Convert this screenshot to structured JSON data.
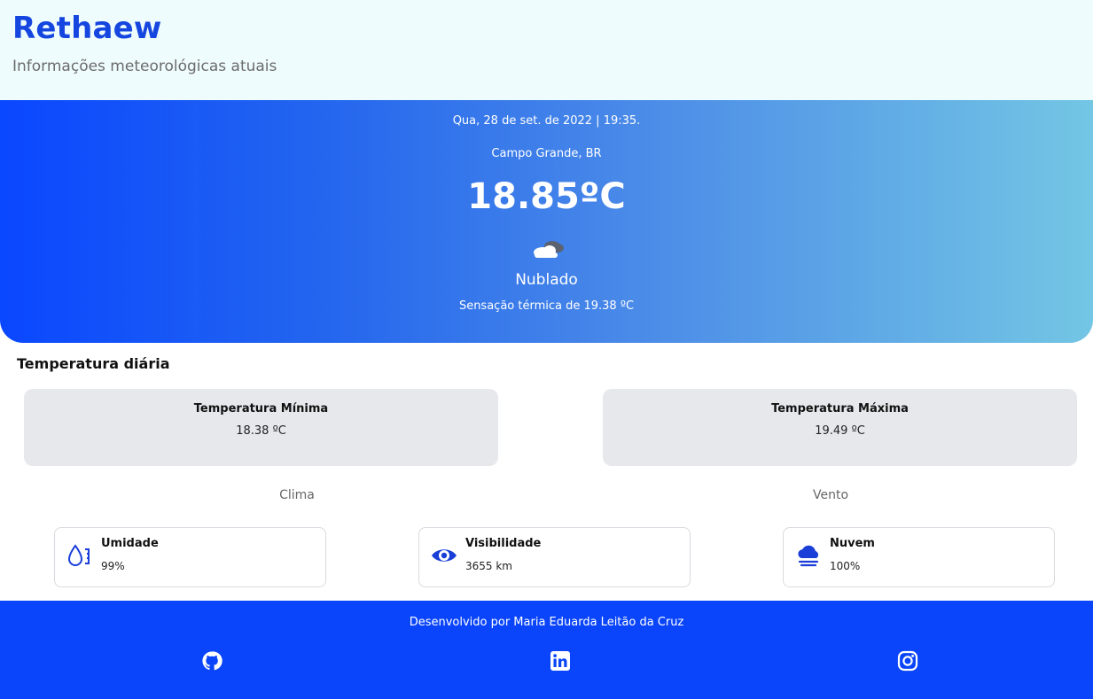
{
  "header": {
    "title": "Rethaew",
    "subtitle": "Informações meteorológicas atuais"
  },
  "current": {
    "datetime": "Qua, 28 de set. de 2022 | 19:35.",
    "location": "Campo Grande, BR",
    "temperature": "18.85ºC",
    "condition_icon": "cloudy-icon",
    "condition": "Nublado",
    "feels_like": "Sensação térmica de 19.38 ºC"
  },
  "daily": {
    "title": "Temperatura diária",
    "min_label": "Temperatura Mínima",
    "min_value": "18.38 ºC",
    "max_label": "Temperatura Máxima",
    "max_value": "19.49 ºC"
  },
  "categories": {
    "weather": "Clima",
    "wind": "Vento"
  },
  "metrics": [
    {
      "icon": "humidity-icon",
      "label": "Umidade",
      "value": "99%"
    },
    {
      "icon": "eye-icon",
      "label": "Visibilidade",
      "value": "3655 km"
    },
    {
      "icon": "cloud-fog-icon",
      "label": "Nuvem",
      "value": "100%"
    }
  ],
  "footer": {
    "credit": "Desenvolvido por Maria Eduarda Leitão da Cruz",
    "social": [
      "github-icon",
      "linkedin-icon",
      "instagram-icon"
    ]
  },
  "colors": {
    "brand": "#1646e0",
    "footer_bg": "#0a45fb",
    "header_bg": "#effcfd",
    "card_bg": "#e6e8ec",
    "hero_start": "#0a47ff",
    "hero_end": "#73c6e4"
  }
}
